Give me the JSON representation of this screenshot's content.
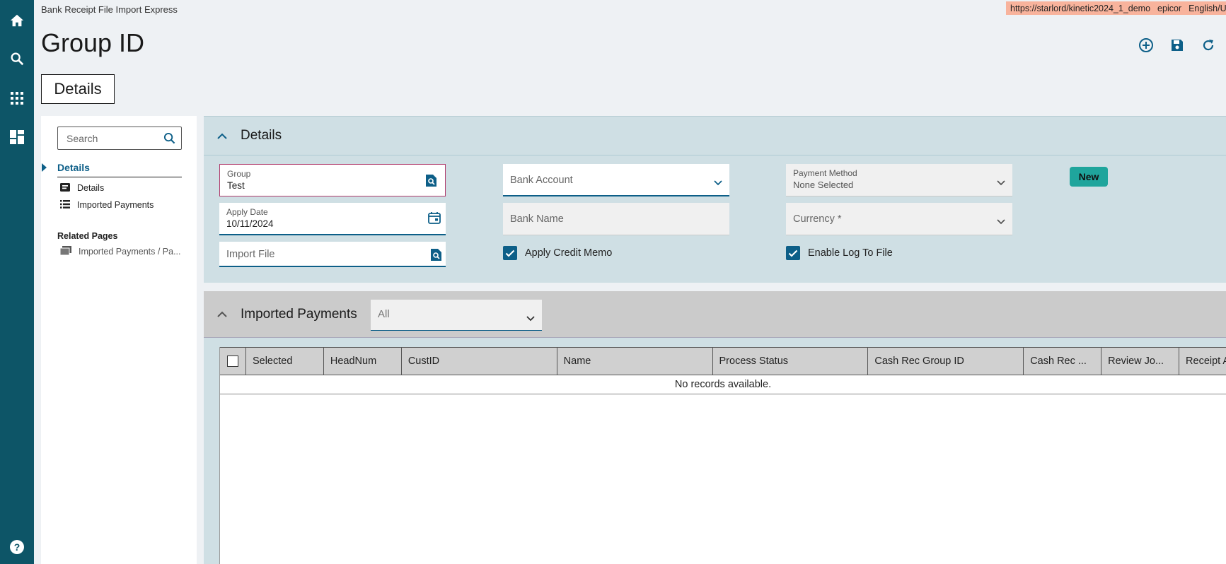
{
  "app": {
    "title": "Bank Receipt File Import Express",
    "env_url": "https://starlord/kinetic2024_1_demo",
    "env_user": "epicor",
    "env_lang": "English/U"
  },
  "header": {
    "page_title": "Group ID",
    "tab_label": "Details"
  },
  "nav": {
    "search_placeholder": "Search",
    "section_label": "Details",
    "items": [
      {
        "label": "Details",
        "icon": "card-icon"
      },
      {
        "label": "Imported Payments",
        "icon": "list-icon"
      }
    ],
    "related_title": "Related Pages",
    "related_items": [
      {
        "label": "Imported Payments / Pa...",
        "icon": "pages-icon"
      }
    ]
  },
  "details": {
    "section_title": "Details",
    "group_label": "Group",
    "group_value": "Test",
    "apply_date_label": "Apply Date",
    "apply_date_value": "10/11/2024",
    "import_file_placeholder": "Import File",
    "bank_account_placeholder": "Bank Account",
    "bank_name_placeholder": "Bank Name",
    "apply_credit_memo_label": "Apply Credit Memo",
    "apply_credit_memo_checked": true,
    "payment_method_label": "Payment Method",
    "payment_method_value": "None Selected",
    "currency_placeholder": "Currency *",
    "enable_log_label": "Enable Log To File",
    "enable_log_checked": true,
    "new_badge": "New"
  },
  "imported_payments": {
    "section_title": "Imported Payments",
    "filter_value": "All",
    "columns": [
      "Selected",
      "HeadNum",
      "CustID",
      "Name",
      "Process Status",
      "Cash Rec Group ID",
      "Cash Rec ...",
      "Review Jo...",
      "Receipt A"
    ],
    "empty_message": "No records available."
  },
  "colors": {
    "rail": "#0d5567",
    "accent": "#0d5f88",
    "section_bg": "#cfdfe4",
    "badge": "#1fa59c",
    "env_bar": "#f8b39c"
  }
}
